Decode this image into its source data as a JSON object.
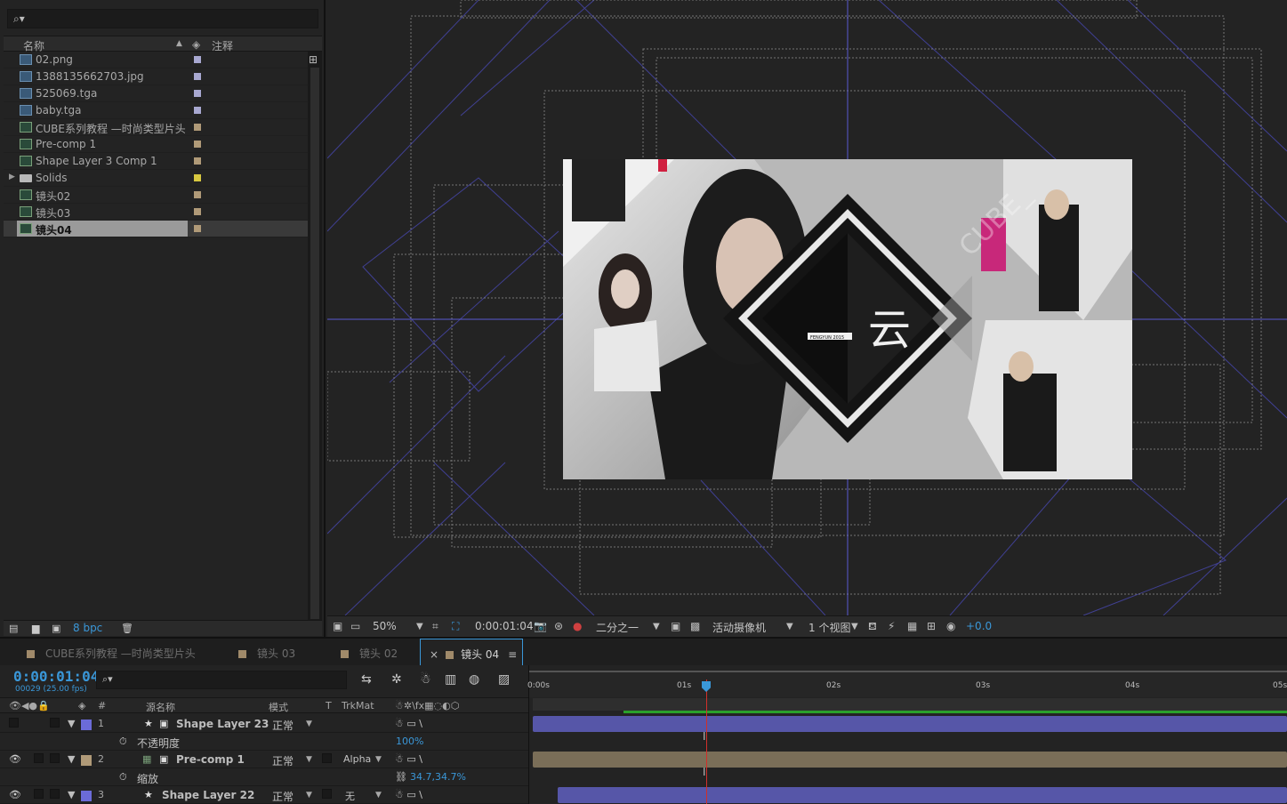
{
  "project": {
    "columns": {
      "name": "名称",
      "comment": "注释"
    },
    "items": [
      {
        "name": "02.png",
        "type": "image",
        "label_color": "#a8a8d0",
        "selected": false
      },
      {
        "name": "1388135662703.jpg",
        "type": "image",
        "label_color": "#a8a8d0",
        "selected": false
      },
      {
        "name": "525069.tga",
        "type": "image",
        "label_color": "#a8a8d0",
        "selected": false
      },
      {
        "name": "baby.tga",
        "type": "image",
        "label_color": "#a8a8d0",
        "selected": false
      },
      {
        "name": "CUBE系列教程 —时尚类型片头",
        "type": "comp",
        "label_color": "#b09a78",
        "selected": false
      },
      {
        "name": "Pre-comp 1",
        "type": "comp",
        "label_color": "#b09a78",
        "selected": false
      },
      {
        "name": "Shape Layer 3 Comp 1",
        "type": "comp",
        "label_color": "#b09a78",
        "selected": false
      },
      {
        "name": "Solids",
        "type": "folder",
        "label_color": "#d8c840",
        "selected": false
      },
      {
        "name": "镜头02",
        "type": "comp",
        "label_color": "#b09a78",
        "selected": false
      },
      {
        "name": "镜头03",
        "type": "comp",
        "label_color": "#b09a78",
        "selected": false
      },
      {
        "name": "镜头04",
        "type": "comp",
        "label_color": "#b09a78",
        "selected": true
      }
    ],
    "footer": {
      "bpc": "8 bpc"
    }
  },
  "viewer": {
    "comp_text": "云",
    "comp_small_text": "FENGYUN 2015",
    "watermark": "CUBE_",
    "toolbar": {
      "zoom": "50%",
      "timecode": "0:00:01:04",
      "resolution": "二分之一",
      "camera": "活动摄像机",
      "views": "1 个视图",
      "exposure": "+0.0"
    }
  },
  "timeline": {
    "tabs": [
      {
        "label": "CUBE系列教程 —时尚类型片头",
        "active": false
      },
      {
        "label": "镜头 03",
        "active": false
      },
      {
        "label": "镜头 02",
        "active": false
      },
      {
        "label": "镜头 04",
        "active": true
      }
    ],
    "current_time": "0:00:01:04",
    "frame_info": "00029 (25.00 fps)",
    "columns": {
      "num": "#",
      "source_name": "源名称",
      "mode": "模式",
      "t": "T",
      "trkmat": "TrkMat"
    },
    "ruler": [
      "0:00s",
      "01s",
      "02s",
      "03s",
      "04s",
      "05s"
    ],
    "layers": [
      {
        "num": "1",
        "name": "Shape Layer 23",
        "mode": "正常",
        "trkmat": "",
        "color": "#6b6bd8",
        "prop_name": "不透明度",
        "prop_value": "100%"
      },
      {
        "num": "2",
        "name": "Pre-comp 1",
        "mode": "正常",
        "trkmat": "Alpha",
        "color": "#b09a78",
        "prop_name": "缩放",
        "prop_value": "34.7,34.7%"
      },
      {
        "num": "3",
        "name": "Shape Layer 22",
        "mode": "正常",
        "trkmat": "无",
        "color": "#6b6bd8"
      }
    ]
  }
}
